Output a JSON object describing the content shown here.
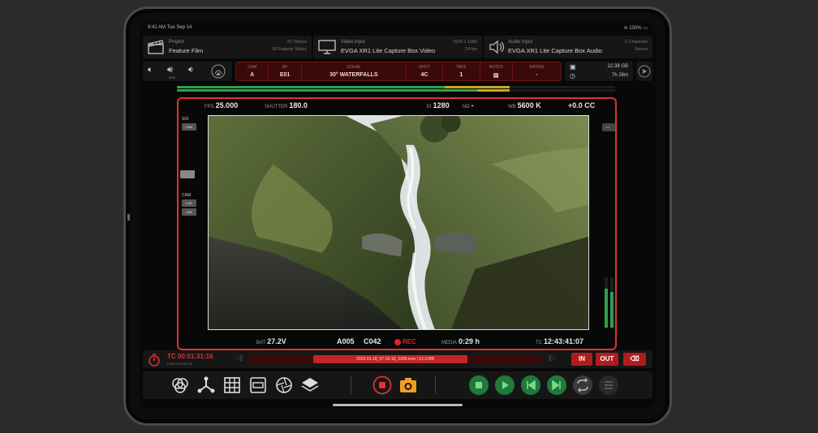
{
  "status": {
    "time": "9:41 AM  Tue Sep 14",
    "battery": "100%"
  },
  "project": {
    "label": "Project",
    "name": "Feature Film",
    "meta1": "22 Videos",
    "meta2": "16 Feature Slides"
  },
  "video_input": {
    "label": "Video input",
    "name": "EVGA XR1 Lite Capture Box Video",
    "meta1": "1920 x 1080",
    "meta2": "24 fps"
  },
  "audio_input": {
    "label": "Audio input",
    "name": "EVGA XR1 Lite Capture Box Audio",
    "meta1": "2 Channels",
    "meta2": "Stereo"
  },
  "volume": {
    "sublabel": "50%"
  },
  "slate": [
    {
      "label": "CAM",
      "value": "A"
    },
    {
      "label": "EP",
      "value": "E01"
    },
    {
      "label": "SCENE",
      "value": "30° WATERFALLS"
    },
    {
      "label": "SHOT",
      "value": "4C"
    },
    {
      "label": "TAKE",
      "value": "1"
    },
    {
      "label": "NOTES",
      "value": ""
    },
    {
      "label": "RATING",
      "value": "-"
    }
  ],
  "storage": {
    "free": "22.38 GB",
    "remaining": "7h 26m"
  },
  "viewer": {
    "fps_label": "FPS",
    "fps": "25.000",
    "shutter_label": "SHUTTER",
    "shutter": "180.0",
    "iso_label": "EI",
    "iso": "1280",
    "nd_label": "ND",
    "nd": "-",
    "wb_label": "WB",
    "wb": "5600 K",
    "tint": "+0.0 CC",
    "bat_label": "BAT",
    "bat": "27.2V",
    "reel": "A005",
    "clip": "C042",
    "rec": "REC",
    "media_label": "MEDIA",
    "media": "0:29 h",
    "tc_label": "TC",
    "tc": "12:43:41:07",
    "sdi_label": "SDI",
    "sdi_val": "LINK",
    "cam_label": "CAM",
    "cam_val1": "3.5K",
    "cam_val2": "50B"
  },
  "timecode": {
    "tc": "TC  00:01:31:16",
    "sub": "DUR  00:00:00:00",
    "file": "2023-01-18_07-16-16_2358.mov  |  12.3 MB",
    "in_label": "IN",
    "out_label": "OUT"
  },
  "colors": {
    "accent_red": "#e23030",
    "green": "#2fa04c",
    "orange": "#f0a020"
  }
}
